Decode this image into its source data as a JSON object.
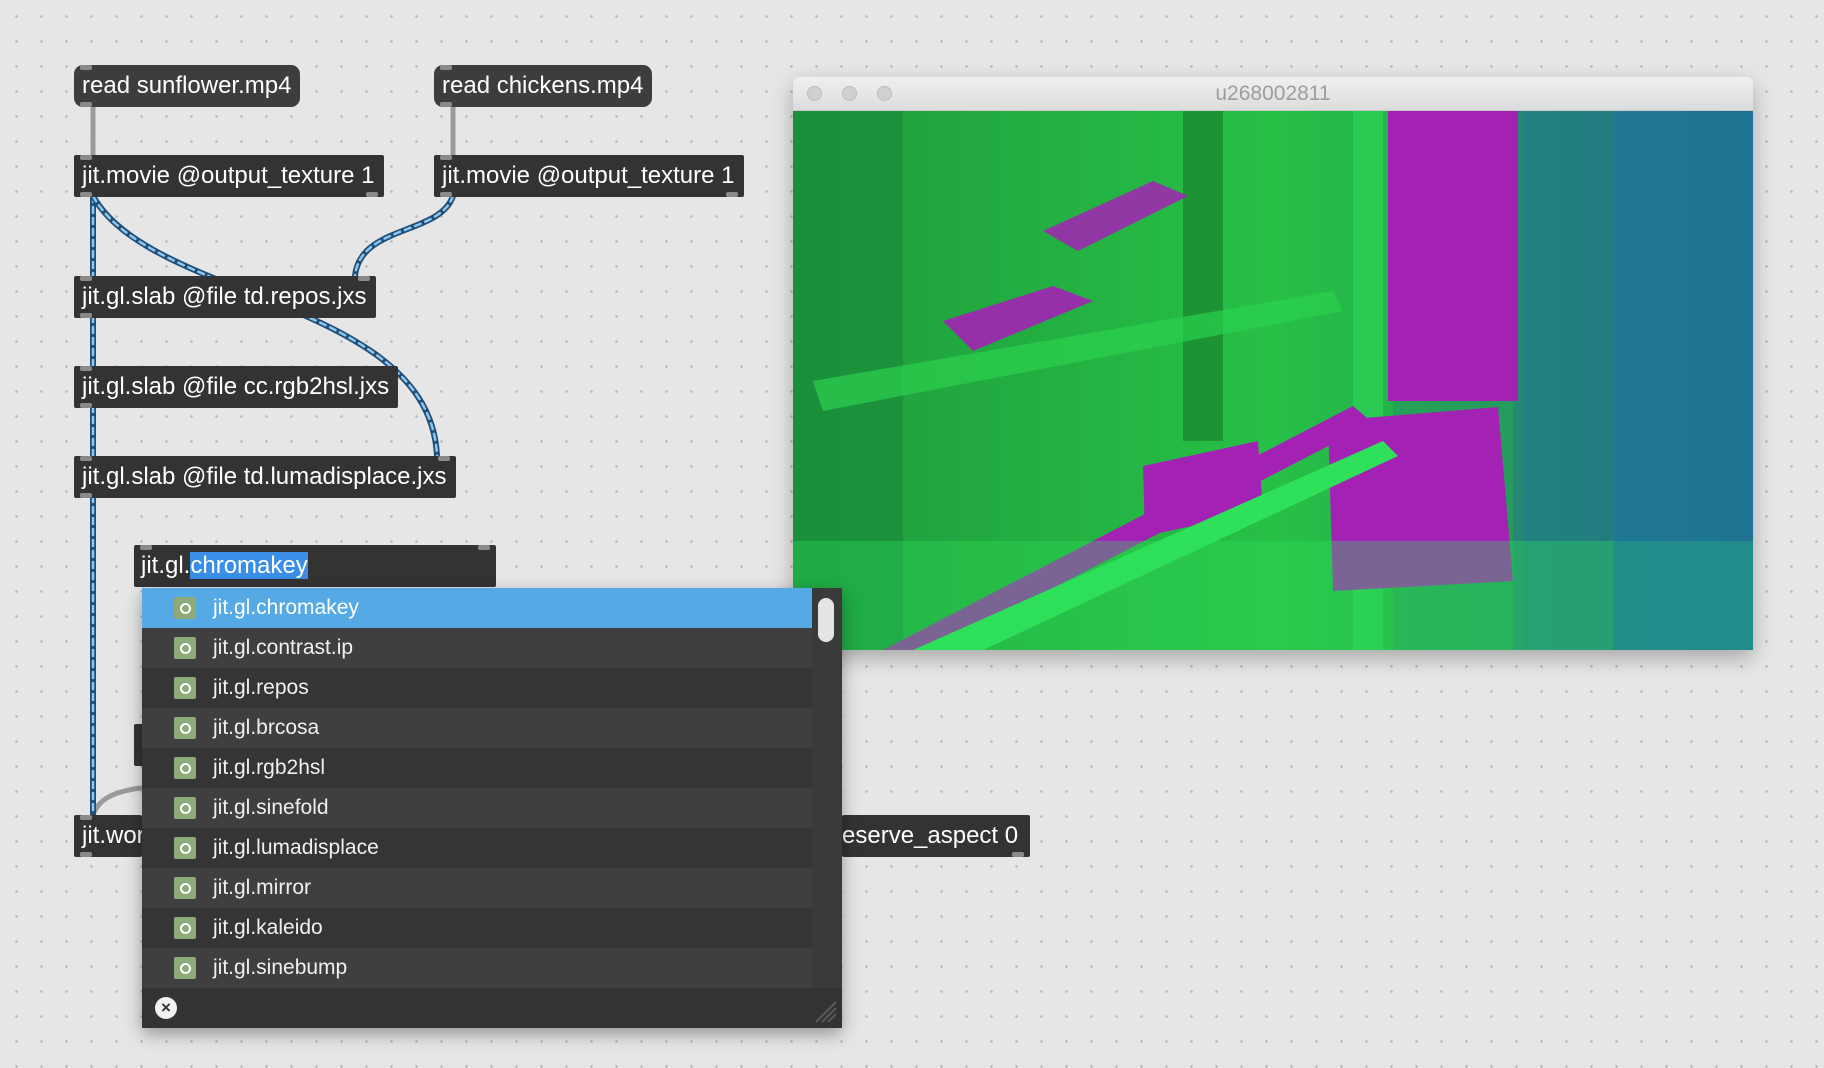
{
  "patch": {
    "message_boxes": [
      {
        "id": "read-sunflower",
        "text": "read sunflower.mp4"
      },
      {
        "id": "read-chickens",
        "text": "read chickens.mp4"
      }
    ],
    "objects": {
      "movie_1": "jit.movie @output_texture 1",
      "movie_2": "jit.movie @output_texture 1",
      "slab_repos": "jit.gl.slab @file td.repos.jxs",
      "slab_rgb2hsl": "jit.gl.slab @file cc.rgb2hsl.jxs",
      "slab_lumadisplace": "jit.gl.slab @file td.lumadisplace.jxs",
      "world_left_fragment": "jit.wor",
      "world_right_fragment": "eserve_aspect 0"
    },
    "editing_box": {
      "prefix": "jit.gl.",
      "selected_text": "chromakey"
    }
  },
  "viewer_window": {
    "title": "u268002811",
    "colors": {
      "green": "#2fd24a",
      "dark_green": "#157a2c",
      "magenta": "#a322b4",
      "blue": "#2a6fb0"
    }
  },
  "autocomplete": {
    "items": [
      {
        "label": "jit.gl.chromakey",
        "icon": "object-icon",
        "selected": true
      },
      {
        "label": "jit.gl.contrast.ip",
        "icon": "object-icon"
      },
      {
        "label": "jit.gl.repos",
        "icon": "object-icon"
      },
      {
        "label": "jit.gl.brcosa",
        "icon": "object-icon"
      },
      {
        "label": "jit.gl.rgb2hsl",
        "icon": "object-icon"
      },
      {
        "label": "jit.gl.sinefold",
        "icon": "object-icon"
      },
      {
        "label": "jit.gl.lumadisplace",
        "icon": "object-icon"
      },
      {
        "label": "jit.gl.mirror",
        "icon": "object-icon"
      },
      {
        "label": "jit.gl.kaleido",
        "icon": "object-icon"
      },
      {
        "label": "jit.gl.sinebump",
        "icon": "object-icon"
      }
    ],
    "close_icon": "close-icon",
    "close_glyph": "×",
    "accent_color": "#55a9e4"
  }
}
